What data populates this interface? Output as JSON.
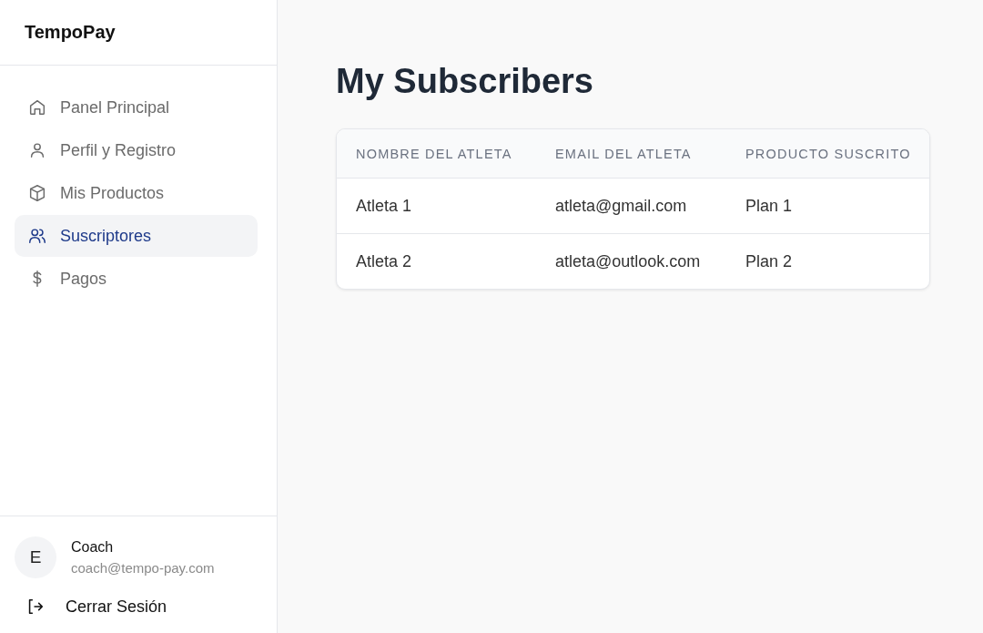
{
  "brand": "TempoPay",
  "sidebar": {
    "items": [
      {
        "label": "Panel Principal",
        "kind": "home",
        "selected": false
      },
      {
        "label": "Perfil y Registro",
        "kind": "user",
        "selected": false
      },
      {
        "label": "Mis Productos",
        "kind": "box",
        "selected": false
      },
      {
        "label": "Suscriptores",
        "kind": "users",
        "selected": true
      },
      {
        "label": "Pagos",
        "kind": "dollar",
        "selected": false
      }
    ]
  },
  "user": {
    "initial": "E",
    "name": "Coach",
    "email": "coach@tempo-pay.com"
  },
  "logout": {
    "label": "Cerrar Sesión"
  },
  "page_title": "My Subscribers",
  "table": {
    "columns": [
      "NOMBRE DEL ATLETA",
      "EMAIL DEL ATLETA",
      "PRODUCTO SUSCRITO"
    ],
    "rows": [
      [
        "Atleta 1",
        "atleta@gmail.com",
        "Plan 1"
      ],
      [
        "Atleta 2",
        "atleta@outlook.com",
        "Plan 2"
      ]
    ]
  }
}
